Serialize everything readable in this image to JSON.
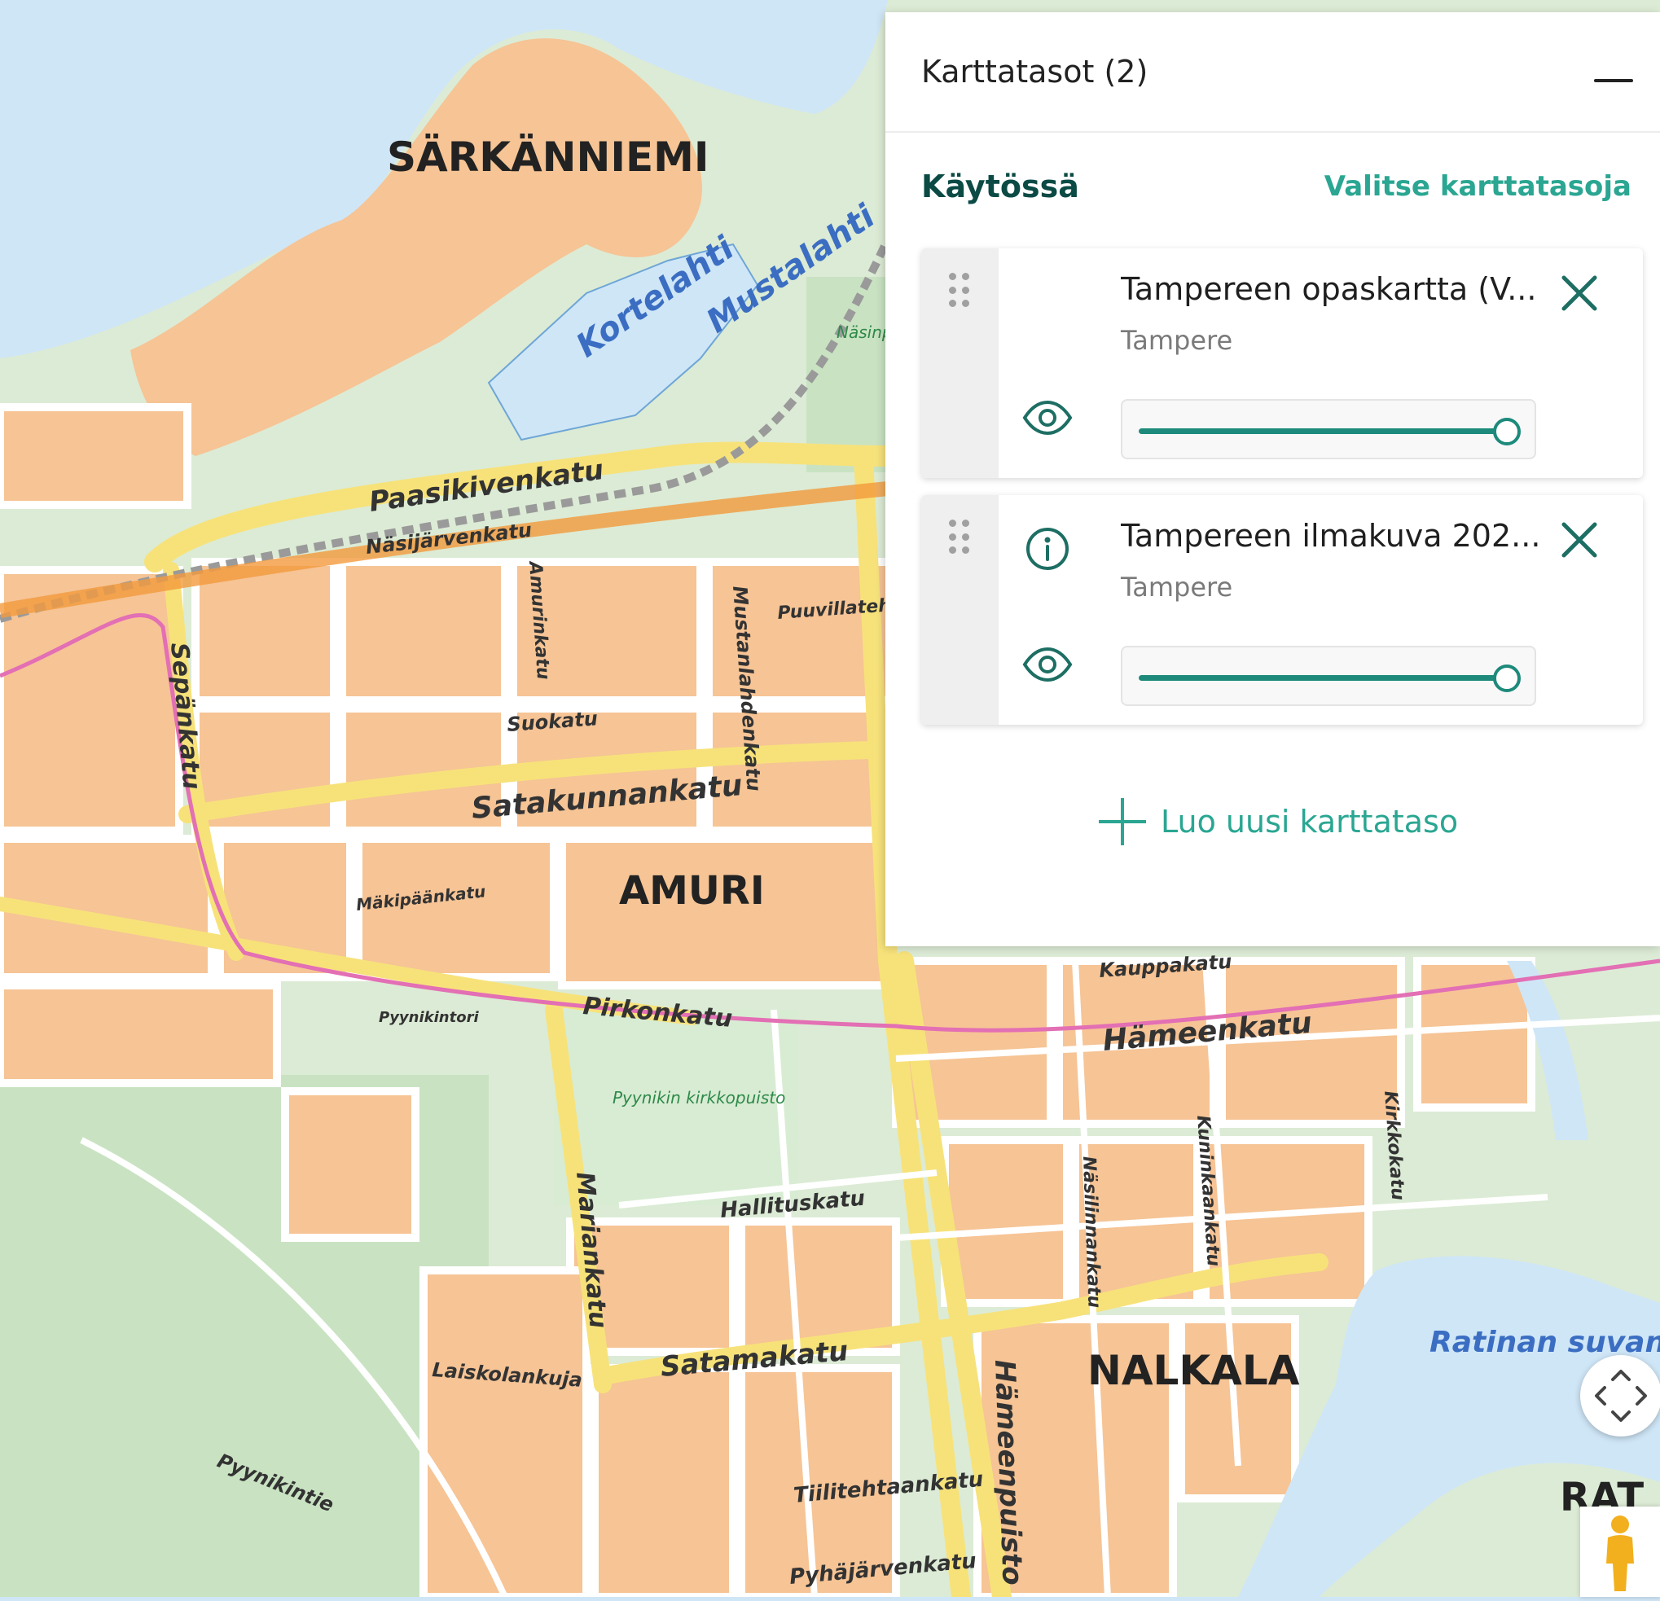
{
  "map": {
    "districts": [
      "SÄRKÄNNIEMI",
      "AMURI",
      "NALKALA",
      "RAT"
    ],
    "streets": [
      "Paasikivenkatu",
      "Näsijärvenkatu",
      "Satakunnankatu",
      "Pirkonkatu",
      "Hämeenkatu",
      "Satamakatu",
      "Mariankatu",
      "Hallituskatu",
      "Pyhäjärvenkatu",
      "Tiilitehtaankatu",
      "Sepänkatu",
      "Hämeenpuisto",
      "Mustanlahdenkatu",
      "Amurinkatu",
      "Suokatu",
      "Mäkipäänkatu",
      "Puuvillatehtaankatu",
      "Kauppakatu",
      "Kuninkaankatu",
      "Näsilinnankatu",
      "Kirkkokatu",
      "Pyynikintie",
      "Laiskolankuja",
      "Pyynikintori"
    ],
    "water_labels": [
      "Kortelahti",
      "Mustalahti",
      "Ratinan suvanto"
    ],
    "park_labels": [
      "Pyynikin kirkkopuisto",
      "Näsinpuisto"
    ]
  },
  "panel": {
    "title": "Karttatasot (2)",
    "section_title": "Käytössä",
    "select_link": "Valitse karttatasoja",
    "layers": [
      {
        "name": "Tampereen opaskartta (V...",
        "subtitle": "Tampere",
        "opacity": 1.0,
        "info_icon": false
      },
      {
        "name": "Tampereen ilmakuva 202...",
        "subtitle": "Tampere",
        "opacity": 1.0,
        "info_icon": true
      }
    ],
    "new_layer_label": "Luo uusi karttataso"
  },
  "colors": {
    "accent": "#1d8a7b",
    "link": "#2aa692",
    "section_title": "#0b4a45",
    "water": "#cfe6f7",
    "land_built": "#f6c495",
    "park": "#d8ecd3",
    "main_road": "#f7e27a",
    "tram_line": "#e36fb4"
  },
  "icons": [
    "minimize-icon",
    "drag-handle-icon",
    "close-icon",
    "info-icon",
    "eye-icon",
    "plus-icon",
    "fullscreen-icon",
    "street-view-icon"
  ]
}
